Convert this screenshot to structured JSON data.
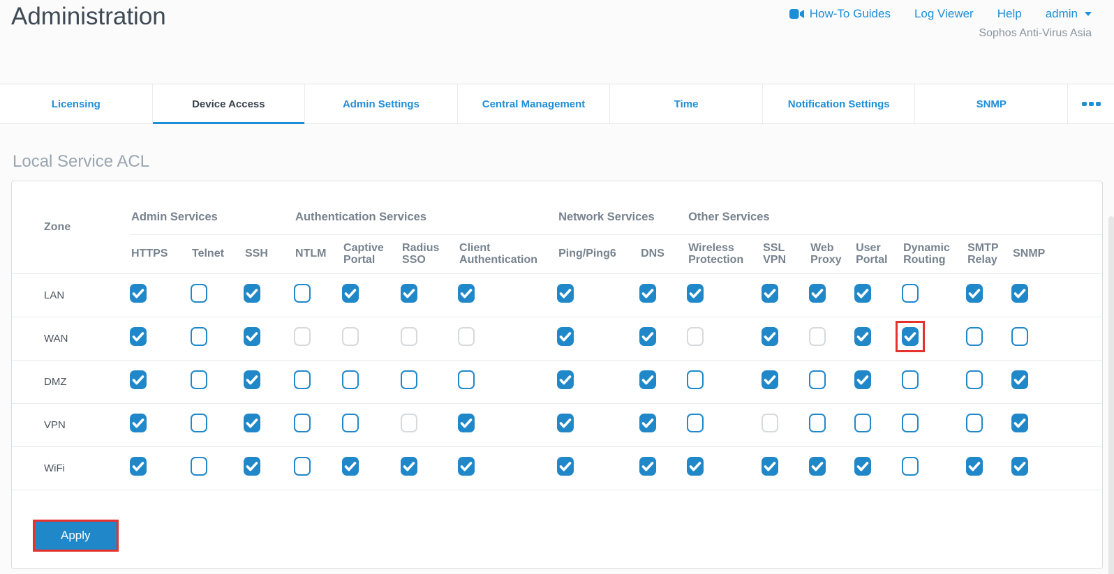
{
  "page": {
    "title": "Administration",
    "account": "Sophos Anti-Virus Asia"
  },
  "topnav": {
    "howto_guides": "How-To Guides",
    "log_viewer": "Log Viewer",
    "help": "Help",
    "user_menu": "admin"
  },
  "tabs": {
    "items": [
      {
        "label": "Licensing",
        "active": false
      },
      {
        "label": "Device Access",
        "active": true
      },
      {
        "label": "Admin Settings",
        "active": false
      },
      {
        "label": "Central Management",
        "active": false
      },
      {
        "label": "Time",
        "active": false
      },
      {
        "label": "Notification Settings",
        "active": false
      },
      {
        "label": "SNMP",
        "active": false
      }
    ]
  },
  "section": {
    "heading": "Local Service ACL"
  },
  "acl_table": {
    "zone_header": "Zone",
    "groups": [
      {
        "label": "Admin Services",
        "span": 3
      },
      {
        "label": "Authentication Services",
        "span": 4
      },
      {
        "label": "Network Services",
        "span": 2
      },
      {
        "label": "Other Services",
        "span": 7
      }
    ],
    "columns": [
      "HTTPS",
      "Telnet",
      "SSH",
      "NTLM",
      "Captive Portal",
      "Radius SSO",
      "Client Authentication",
      "Ping/Ping6",
      "DNS",
      "Wireless Protection",
      "SSL VPN",
      "Web Proxy",
      "User Portal",
      "Dynamic Routing",
      "SMTP Relay",
      "SNMP"
    ],
    "rows": [
      {
        "zone": "LAN",
        "states": [
          "checked",
          "unchecked",
          "checked",
          "unchecked",
          "checked",
          "checked",
          "checked",
          "checked",
          "checked",
          "checked",
          "checked",
          "checked",
          "checked",
          "unchecked",
          "checked",
          "checked"
        ]
      },
      {
        "zone": "WAN",
        "states": [
          "checked",
          "unchecked",
          "checked",
          "disabled",
          "disabled",
          "disabled",
          "disabled",
          "checked",
          "checked",
          "disabled",
          "checked",
          "disabled",
          "checked",
          "checked",
          "unchecked",
          "unchecked"
        ]
      },
      {
        "zone": "DMZ",
        "states": [
          "checked",
          "unchecked",
          "checked",
          "unchecked",
          "unchecked",
          "unchecked",
          "unchecked",
          "checked",
          "checked",
          "unchecked",
          "checked",
          "unchecked",
          "checked",
          "unchecked",
          "unchecked",
          "checked"
        ]
      },
      {
        "zone": "VPN",
        "states": [
          "checked",
          "unchecked",
          "checked",
          "unchecked",
          "unchecked",
          "disabled",
          "checked",
          "checked",
          "checked",
          "unchecked",
          "disabled",
          "unchecked",
          "unchecked",
          "unchecked",
          "unchecked",
          "checked"
        ]
      },
      {
        "zone": "WiFi",
        "states": [
          "checked",
          "unchecked",
          "checked",
          "unchecked",
          "checked",
          "checked",
          "checked",
          "checked",
          "checked",
          "checked",
          "checked",
          "checked",
          "checked",
          "unchecked",
          "checked",
          "checked"
        ]
      }
    ],
    "highlighted_cell": {
      "zone": "WAN",
      "column": "Dynamic Routing"
    }
  },
  "actions": {
    "apply_label": "Apply",
    "apply_highlighted": true
  },
  "colors": {
    "accent_blue": "#1e8ed6",
    "checkbox_blue": "#2088c9",
    "highlight_red": "#e5322c",
    "heading_gray": "#9aa5b0",
    "header_text": "#76828e",
    "title_color": "#3d4954"
  }
}
